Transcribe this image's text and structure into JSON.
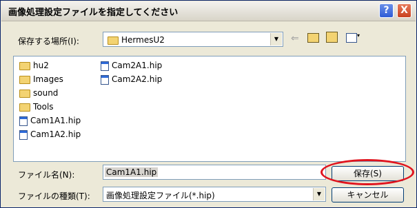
{
  "window": {
    "title": "画像処理設定ファイルを指定してください",
    "help_glyph": "?",
    "close_glyph": "X"
  },
  "location": {
    "label": "保存する場所(I):",
    "value": "HermesU2"
  },
  "files": {
    "col1": [
      {
        "name": "hu2",
        "icon": "folder-icon"
      },
      {
        "name": "Images",
        "icon": "folder-icon"
      },
      {
        "name": "sound",
        "icon": "folder-icon"
      },
      {
        "name": "Tools",
        "icon": "folder-icon"
      },
      {
        "name": "Cam1A1.hip",
        "icon": "hip-file-icon"
      },
      {
        "name": "Cam1A2.hip",
        "icon": "hip-file-icon"
      }
    ],
    "col2": [
      {
        "name": "Cam2A1.hip",
        "icon": "hip-file-icon"
      },
      {
        "name": "Cam2A2.hip",
        "icon": "hip-file-icon"
      }
    ]
  },
  "filename": {
    "label": "ファイル名(N):",
    "value": "Cam1A1.hip"
  },
  "filetype": {
    "label": "ファイルの種類(T):",
    "value": "画像処理設定ファイル(*.hip)"
  },
  "buttons": {
    "save": "保存(S)",
    "cancel": "キャンセル"
  },
  "colors": {
    "highlight_ellipse": "#e0141e"
  }
}
